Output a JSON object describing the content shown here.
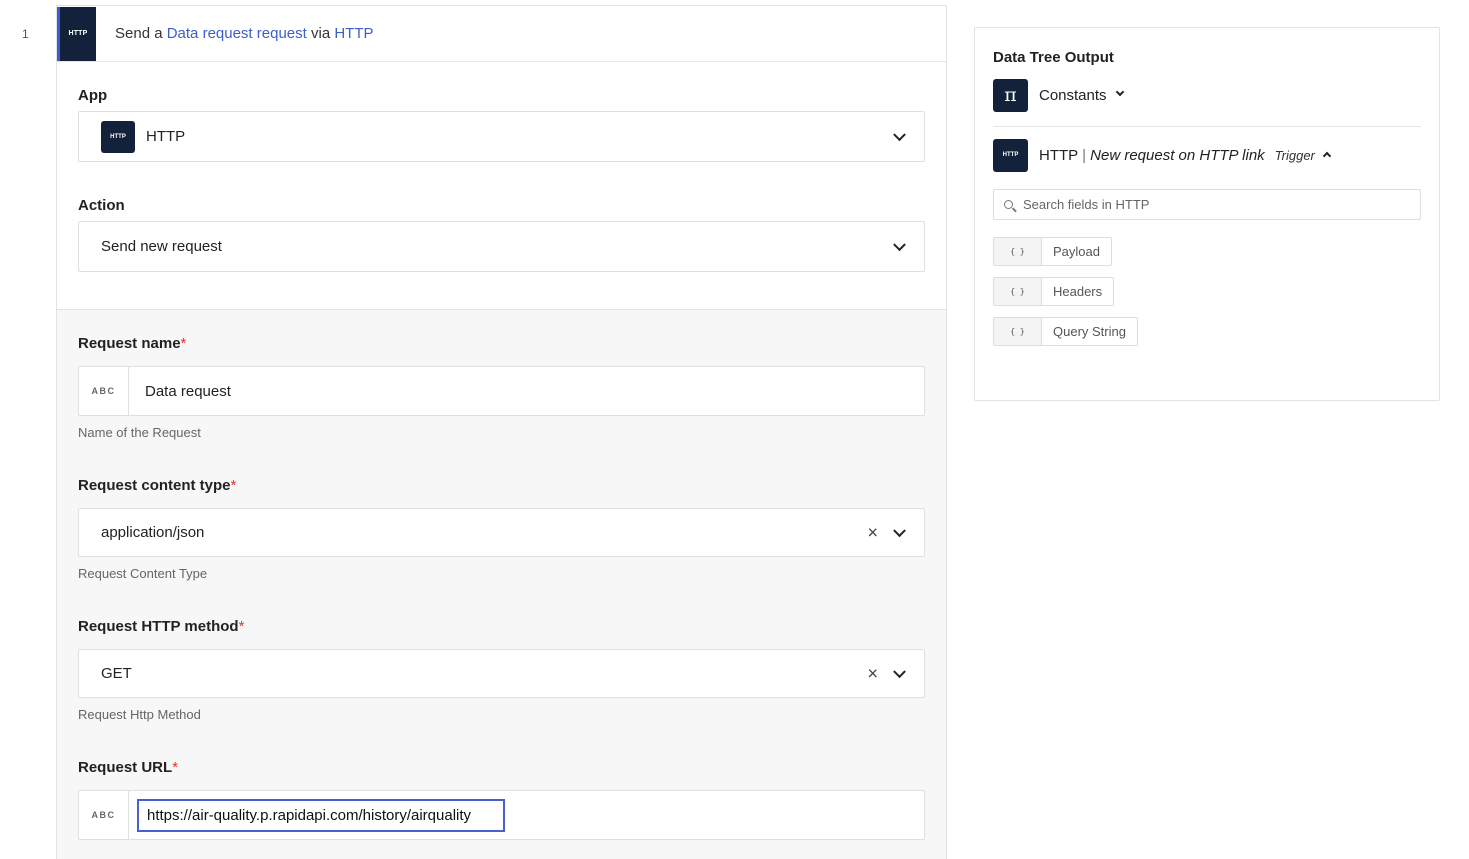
{
  "step": {
    "number": "1",
    "logo_text": "HTTP",
    "title_prefix": "Send a",
    "title_link": "Data request request",
    "title_via": "via",
    "title_app": "HTTP"
  },
  "app_field": {
    "label": "App",
    "logo_text": "HTTP",
    "value": "HTTP"
  },
  "action_field": {
    "label": "Action",
    "value": "Send new request"
  },
  "request_name": {
    "label": "Request name",
    "required": "*",
    "prefix": "ABC",
    "value": "Data request",
    "help": "Name of the Request"
  },
  "content_type": {
    "label": "Request content type",
    "required": "*",
    "value": "application/json",
    "clear": "×",
    "help": "Request Content Type"
  },
  "http_method": {
    "label": "Request HTTP method",
    "required": "*",
    "value": "GET",
    "clear": "×",
    "help": "Request Http Method"
  },
  "request_url": {
    "label": "Request URL",
    "required": "*",
    "prefix": "ABC",
    "value": "https://air-quality.p.rapidapi.com/history/airquality"
  },
  "side": {
    "title": "Data Tree Output",
    "constants": {
      "icon": "π",
      "label": "Constants"
    },
    "http_source": {
      "logo_text": "HTTP",
      "app": "HTTP",
      "separator": "|",
      "event": "New request on HTTP link",
      "badge": "Trigger"
    },
    "search_placeholder": "Search fields in HTTP",
    "fields": [
      {
        "icon": "{ }",
        "label": "Payload"
      },
      {
        "icon": "{ }",
        "label": "Headers"
      },
      {
        "icon": "{ }",
        "label": "Query String"
      }
    ]
  }
}
